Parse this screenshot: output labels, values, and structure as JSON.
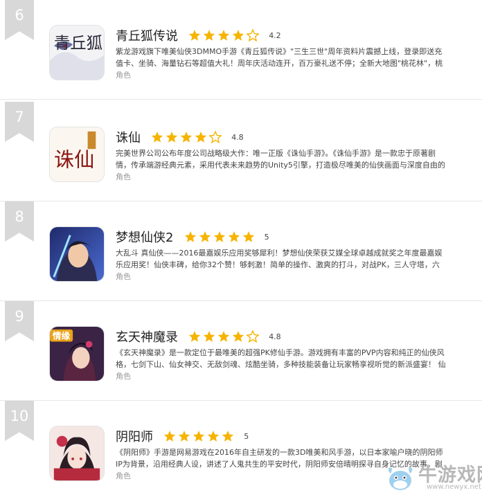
{
  "items": [
    {
      "rank": "6",
      "name": "青丘狐传说",
      "rating": 4,
      "score": "4.2",
      "description": "紫龙游戏旗下唯美仙侠3DMMO手游《青丘狐传说》\"三生三世\"周年资料片震撼上线，登录即送充值卡、坐骑、海量钻石等超值大礼！周年庆活动连开，百万豪礼送不停；全新大地图\"桃花林\"，桃花",
      "category": "角色",
      "icon": "fox-game-icon",
      "icon_text": "青丘狐"
    },
    {
      "rank": "7",
      "name": "诛仙",
      "rating": 4,
      "score": "4.8",
      "description": "完美世界公司公布年度公司战略级大作：唯一正版《诛仙手游》。《诛仙手游》是一款忠于原著剧情，传承端游经典元素，采用代表未来趋势的Unity5引擎，打造极尽唯美的仙侠画面与深度自由的",
      "category": "角色",
      "icon": "zhuxian-calligraphy-icon",
      "icon_text": "诛仙"
    },
    {
      "rank": "8",
      "name": "梦想仙侠2",
      "rating": 5,
      "score": "5",
      "description": "大乱斗 真仙侠——2016最嘉娱乐应用奖够犀利！梦想仙侠荣获艾媒全球卓越成就奖之年度最嘉娱乐应用奖！仙侠丰碑，给你32个赞！够刺激！简单的操作、激爽的打斗，对战PK，三人守塔，六人对",
      "category": "角色",
      "icon": "swordsman-portrait-icon",
      "icon_text": ""
    },
    {
      "rank": "9",
      "name": "玄天神魔录",
      "rating": 4,
      "score": "4.8",
      "description": "《玄天神魔录》是一款定位于最唯美的超强PK修仙手游。游戏拥有丰富的PVP内容和纯正的仙侠风格，七剑下山、仙女神交、无敌剑魂、炫酷坐骑，多种技能装备让玩家畅享视听觉的新派盛宴！ 仙",
      "category": "角色",
      "icon": "heroine-portrait-icon",
      "icon_text": "情缘"
    },
    {
      "rank": "10",
      "name": "阴阳师",
      "rating": 5,
      "score": "5",
      "description": "《阴阳师》手游是网易游戏在2016年自主研发的一款3D唯美和风手游，以日本家喻户晓的阴阳师IP为背景，沿用经典人设，讲述了人鬼共生的平安时代，阴阳师安倍晴明探寻自身记忆的故事。剧情",
      "category": "角色",
      "icon": "onmyoji-girl-icon",
      "icon_text": ""
    }
  ],
  "watermark": {
    "brand": "牛游戏网",
    "url": "www.newyx.net"
  },
  "colors": {
    "star_filled": "#f6b400",
    "star_empty": "#f6b400",
    "rank_badge": "#d8d8d8",
    "divider": "#e6e6e6"
  }
}
